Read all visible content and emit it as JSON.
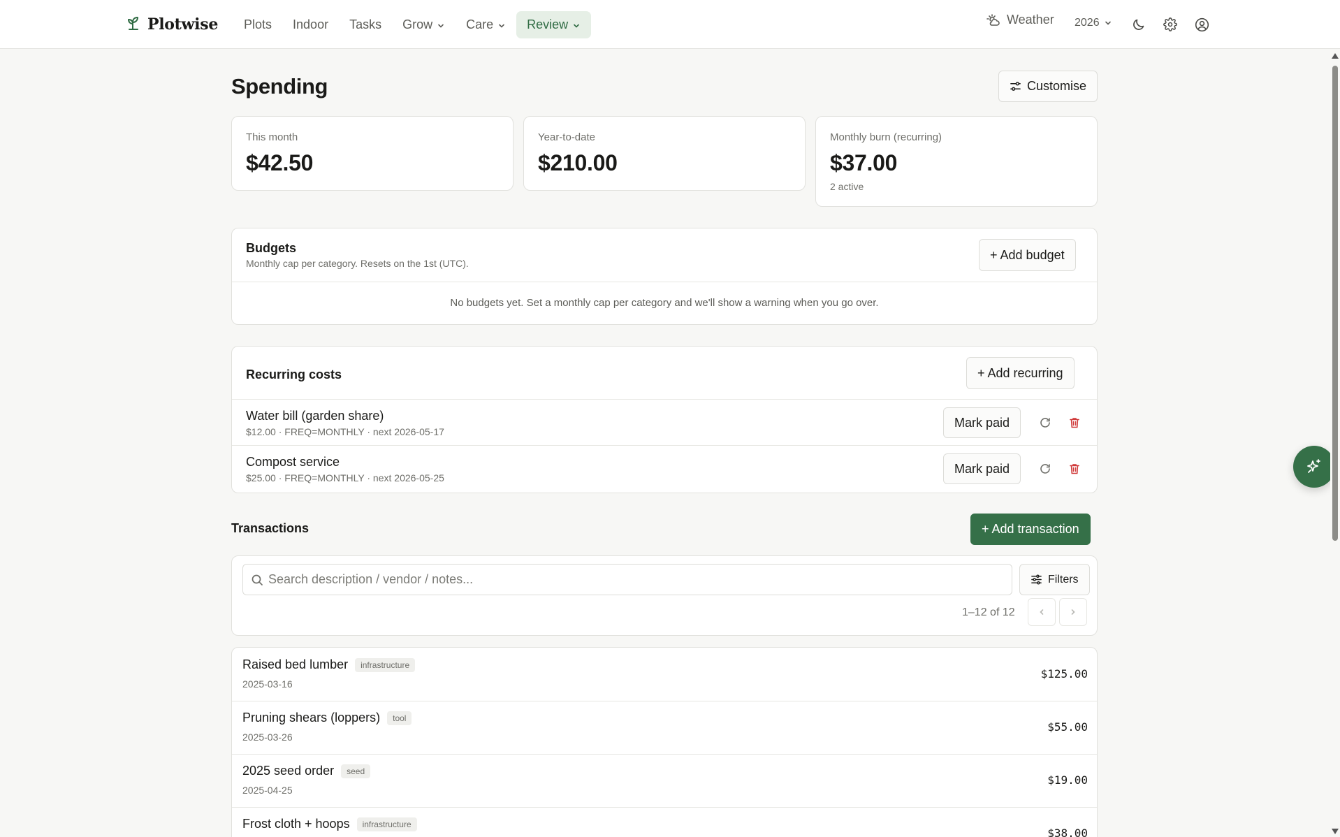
{
  "app": {
    "name": "Plotwise",
    "logo_icon": "sprout-icon"
  },
  "nav": {
    "items": [
      {
        "label": "Plots",
        "dropdown": false,
        "active": false
      },
      {
        "label": "Indoor",
        "dropdown": false,
        "active": false
      },
      {
        "label": "Tasks",
        "dropdown": false,
        "active": false
      },
      {
        "label": "Grow",
        "dropdown": true,
        "active": false
      },
      {
        "label": "Care",
        "dropdown": true,
        "active": false
      },
      {
        "label": "Review",
        "dropdown": true,
        "active": true
      }
    ]
  },
  "header_right": {
    "weather_label": "Weather",
    "year": "2026",
    "icons": [
      "weather-icon",
      "moon-icon",
      "gear-icon",
      "user-icon"
    ]
  },
  "page": {
    "title": "Spending",
    "customise_label": "Customise"
  },
  "stats": [
    {
      "label": "This month",
      "value": "$42.50",
      "sub": ""
    },
    {
      "label": "Year-to-date",
      "value": "$210.00",
      "sub": ""
    },
    {
      "label": "Monthly burn (recurring)",
      "value": "$37.00",
      "sub": "2 active"
    }
  ],
  "budgets": {
    "title": "Budgets",
    "subtitle": "Monthly cap per category. Resets on the 1st (UTC).",
    "add_label": "+ Add budget",
    "empty_text": "No budgets yet. Set a monthly cap per category and we'll show a warning when you go over."
  },
  "recurring": {
    "title": "Recurring costs",
    "add_label": "+ Add recurring",
    "mark_paid_label": "Mark paid",
    "items": [
      {
        "name": "Water bill (garden share)",
        "meta": "$12.00 · FREQ=MONTHLY · next 2026-05-17"
      },
      {
        "name": "Compost service",
        "meta": "$25.00 · FREQ=MONTHLY · next 2026-05-25"
      }
    ]
  },
  "transactions": {
    "title": "Transactions",
    "add_label": "+ Add transaction",
    "search_placeholder": "Search description / vendor / notes...",
    "filters_label": "Filters",
    "pager_text": "1–12 of 12",
    "items": [
      {
        "name": "Raised bed lumber",
        "tag": "infrastructure",
        "date": "2025-03-16",
        "amount": "$125.00"
      },
      {
        "name": "Pruning shears (loppers)",
        "tag": "tool",
        "date": "2025-03-26",
        "amount": "$55.00"
      },
      {
        "name": "2025 seed order",
        "tag": "seed",
        "date": "2025-04-25",
        "amount": "$19.00"
      },
      {
        "name": "Frost cloth + hoops",
        "tag": "infrastructure",
        "date": "",
        "amount": "$38.00"
      }
    ]
  },
  "colors": {
    "accent": "#357048",
    "active_nav_bg": "#e6efe6",
    "danger": "#d03a3a",
    "background": "#f7f7f5"
  },
  "fab_icon": "sparkle-icon"
}
